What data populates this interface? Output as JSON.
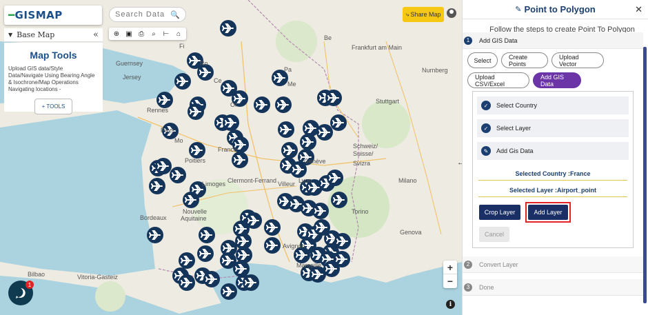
{
  "map": {
    "logo": "GISMAP",
    "search_placeholder": "Search Data",
    "base_map_label": "Base Map",
    "tools": {
      "title": "Map Tools",
      "description": "Upload GIS data/Style Data/Navigate Using Bearing Angle & Isochrone/Map Operations Navigating locations -",
      "button": "+ TOOLS"
    },
    "share_label": "Share Map",
    "zoom_in": "+",
    "zoom_out": "−",
    "chat_badge": "1",
    "labels": [
      {
        "name": "label-guernsey",
        "text": "Guernsey"
      },
      {
        "name": "label-jersey",
        "text": "Jersey"
      },
      {
        "name": "label-rennes",
        "text": "Rennes"
      },
      {
        "name": "label-pays",
        "text": "Pays"
      },
      {
        "name": "label-poitiers",
        "text": "Poitiers"
      },
      {
        "name": "label-limoges",
        "text": "Limoges"
      },
      {
        "name": "label-nouvelle",
        "text": "Nouvelle"
      },
      {
        "name": "label-aquitaine",
        "text": "Aquitaine"
      },
      {
        "name": "label-bordeaux",
        "text": "Bordeaux"
      },
      {
        "name": "label-clermont",
        "text": "Clermont-Ferrand"
      },
      {
        "name": "label-lyon",
        "text": "Lyon"
      },
      {
        "name": "label-villeur",
        "text": "Villeur"
      },
      {
        "name": "label-france",
        "text": "France"
      },
      {
        "name": "label-frankfurt",
        "text": "Frankfurt am Main"
      },
      {
        "name": "label-nurnberg",
        "text": "Nurnberg"
      },
      {
        "name": "label-stuttgart",
        "text": "Stuttgart"
      },
      {
        "name": "label-schweiz",
        "text": "Schweiz/"
      },
      {
        "name": "label-suisse",
        "text": "Suisse/"
      },
      {
        "name": "label-svizra",
        "text": "Svizra"
      },
      {
        "name": "label-geneve",
        "text": "Genève"
      },
      {
        "name": "label-milano",
        "text": "Milano"
      },
      {
        "name": "label-torino",
        "text": "Torino"
      },
      {
        "name": "label-genova",
        "text": "Genova"
      },
      {
        "name": "label-avignon",
        "text": "Avignon"
      },
      {
        "name": "label-marseille",
        "text": "Marseille"
      },
      {
        "name": "label-vitoria",
        "text": "Vitoria-Gasteiz"
      },
      {
        "name": "label-bilbao",
        "text": "Bilbao"
      },
      {
        "name": "label-fi",
        "text": "Fi"
      },
      {
        "name": "label-mo",
        "text": "Mo"
      },
      {
        "name": "label-be",
        "text": "Be"
      },
      {
        "name": "label-pa",
        "text": "Pa"
      },
      {
        "name": "label-or",
        "text": "Or"
      },
      {
        "name": "label-me",
        "text": "Me"
      },
      {
        "name": "label-ro",
        "text": "Ro"
      },
      {
        "name": "label-ce",
        "text": "Ce"
      }
    ]
  },
  "panel": {
    "title": "Point to Polygon",
    "subtitle": "Follow the steps to create Point To Polygon properly",
    "steps": [
      {
        "num": "1",
        "label": "Add GIS Data"
      },
      {
        "num": "2",
        "label": "Convert Layer"
      },
      {
        "num": "3",
        "label": "Done"
      }
    ],
    "buttons_row1": [
      "Select",
      "Create Points",
      "Upload Vector"
    ],
    "buttons_row2": [
      "Upload CSV/Excel",
      "Add GIS Data"
    ],
    "checks": [
      "Select Country",
      "Select Layer",
      "Add Gis Data"
    ],
    "selected_country": "Selected Country :France",
    "selected_layer": "Selected Layer :Airport_point",
    "crop_label": "Crop Layer",
    "add_label": "Add Layer",
    "cancel_label": "Cancel"
  }
}
